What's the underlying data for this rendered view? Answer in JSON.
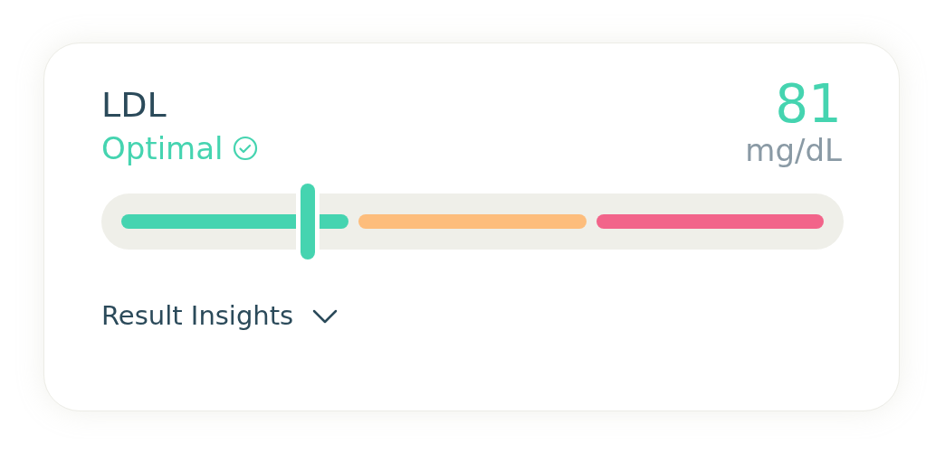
{
  "result": {
    "name": "LDL",
    "status": "Optimal",
    "value": "81",
    "unit": "mg/dL"
  },
  "range": {
    "segments": [
      {
        "color": "#45d4b0"
      },
      {
        "color": "#fdbd7c"
      },
      {
        "color": "#f2648a"
      }
    ]
  },
  "insights": {
    "label": "Result Insights",
    "expanded": false
  }
}
